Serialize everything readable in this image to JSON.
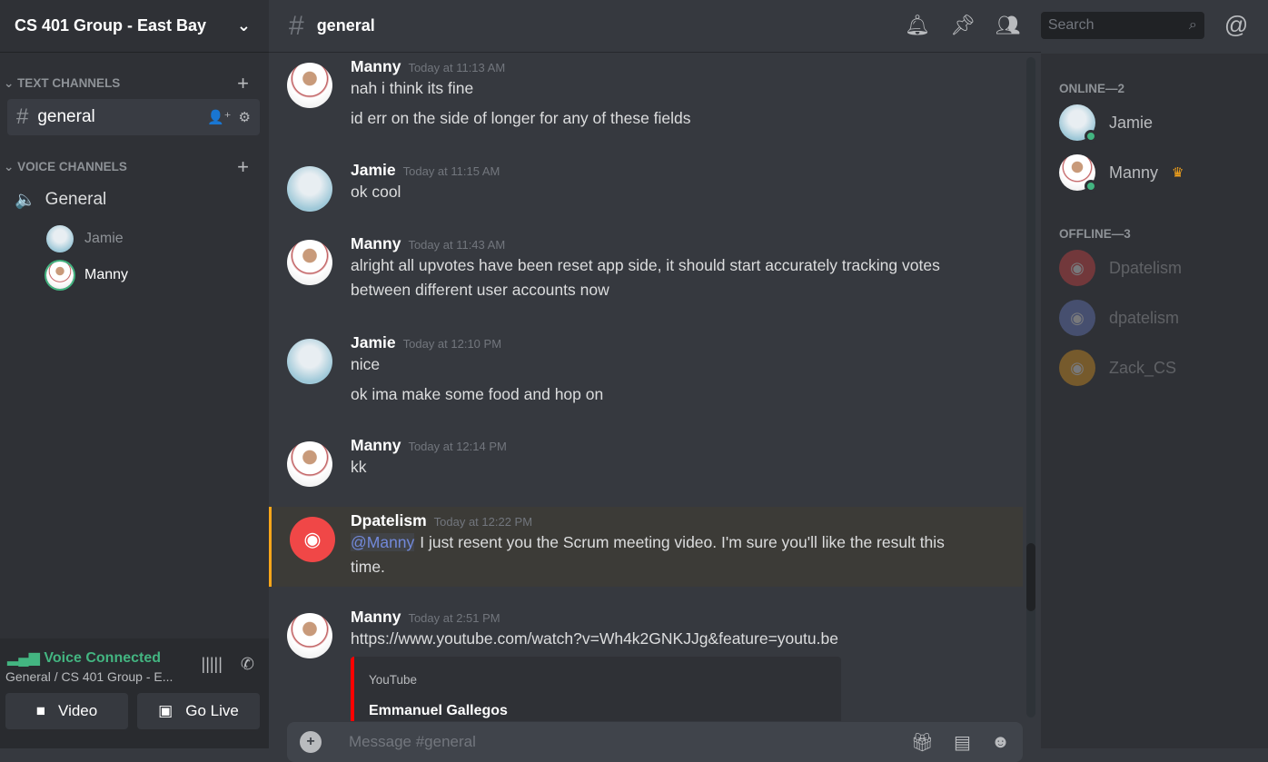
{
  "server": {
    "name": "CS 401 Group - East Bay"
  },
  "text_category": "TEXT CHANNELS",
  "voice_category": "VOICE CHANNELS",
  "text_channel": "general",
  "voice_channel": "General",
  "voice_users": [
    "Jamie",
    "Manny"
  ],
  "voice_panel": {
    "status": "Voice Connected",
    "location": "General / CS 401 Group - E...",
    "video_label": "Video",
    "golive_label": "Go Live"
  },
  "header": {
    "channel": "general",
    "search_placeholder": "Search"
  },
  "messages": [
    {
      "author": "Manny",
      "time": "Today at 11:13 AM",
      "lines": [
        "nah i think its fine",
        "id err on the side of longer for any of these fields"
      ]
    },
    {
      "author": "Jamie",
      "time": "Today at 11:15 AM",
      "lines": [
        "ok cool"
      ]
    },
    {
      "author": "Manny",
      "time": "Today at 11:43 AM",
      "lines": [
        "alright all upvotes have been reset app side, it should start accurately tracking votes between different user accounts now"
      ]
    },
    {
      "author": "Jamie",
      "time": "Today at 12:10 PM",
      "lines": [
        "nice",
        "ok ima make some food and hop on"
      ]
    },
    {
      "author": "Manny",
      "time": "Today at 12:14 PM",
      "lines": [
        "kk"
      ]
    },
    {
      "author": "Dpatelism",
      "time": "Today at 12:22 PM",
      "mention": "@Manny",
      "lines": [
        "I just resent you the Scrum meeting video. I'm sure you'll like the result this time."
      ]
    },
    {
      "author": "Manny",
      "time": "Today at 2:51 PM",
      "link": "https://www.youtube.com/watch?v=Wh4k2GNKJJg&feature=youtu.be",
      "embed": {
        "provider": "YouTube",
        "title": "Emmanuel Gallegos"
      }
    }
  ],
  "composer": {
    "placeholder": "Message #general"
  },
  "members": {
    "online_header": "ONLINE—2",
    "online": [
      {
        "name": "Jamie"
      },
      {
        "name": "Manny",
        "crown": "♛"
      }
    ],
    "offline_header": "OFFLINE—3",
    "offline": [
      {
        "name": "Dpatelism",
        "color": "#f04747"
      },
      {
        "name": "dpatelism",
        "color": "#7289da"
      },
      {
        "name": "Zack_CS",
        "color": "#faa61a"
      }
    ]
  }
}
